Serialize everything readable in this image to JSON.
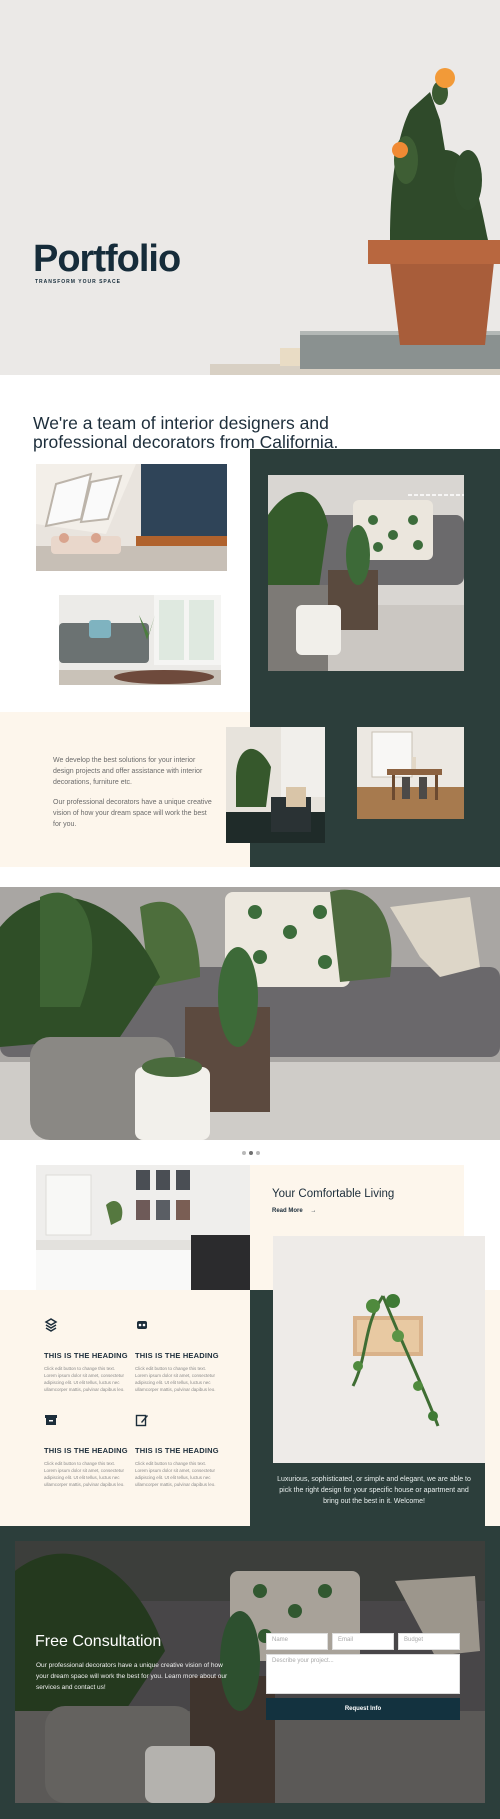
{
  "hero": {
    "title": "Portfolio",
    "subtitle": "TRANSFORM YOUR SPACE"
  },
  "intro": {
    "heading": "We're a team of interior designers and professional decorators from California."
  },
  "about": {
    "paragraph1": "We develop the best solutions for your interior design projects and offer assistance with interior decorations, furniture etc.",
    "paragraph2": "Our professional decorators have a unique creative vision of how your dream space will work the best for you."
  },
  "slider": {
    "dots": 3,
    "active": 1
  },
  "living": {
    "title": "Your Comfortable Living",
    "read_more": "Read More",
    "arrow": "→"
  },
  "features": [
    {
      "icon": "layers-icon",
      "heading": "THIS IS THE HEADING",
      "text": "Click edit button to change this text. Lorem ipsum dolor sit amet, consectetur adipiscing elit. Ut elit tellus, luctus nec ullamcorper mattis, pulvinar dapibus leo."
    },
    {
      "icon": "robot-icon",
      "heading": "THIS IS THE HEADING",
      "text": "Click edit button to change this text. Lorem ipsum dolor sit amet, consectetur adipiscing elit. Ut elit tellus, luctus nec ullamcorper mattis, pulvinar dapibus leo."
    },
    {
      "icon": "archive-icon",
      "heading": "THIS IS THE HEADING",
      "text": "Click edit button to change this text. Lorem ipsum dolor sit amet, consectetur adipiscing elit. Ut elit tellus, luctus nec ullamcorper mattis, pulvinar dapibus leo."
    },
    {
      "icon": "edit-icon",
      "heading": "THIS IS THE HEADING",
      "text": "Click edit button to change this text. Lorem ipsum dolor sit amet, consectetur adipiscing elit. Ut elit tellus, luctus nec ullamcorper mattis, pulvinar dapibus leo."
    }
  ],
  "welcome": {
    "text": "Luxurious, sophisticated, or simple and elegant, we are able to pick the right design for your specific house or apartment and bring out the best in it. Welcome!"
  },
  "consultation": {
    "title": "Free Consultation",
    "text": "Our professional decorators have a unique creative vision of how your dream space will work the best for you. Learn more about our services and contact us!",
    "name_placeholder": "Name",
    "email_placeholder": "Email",
    "budget_placeholder": "Budget",
    "message_placeholder": "Describe your project...",
    "submit_label": "Request Info"
  },
  "colors": {
    "dark_green": "#2c3e3b",
    "cream": "#fdf6ec",
    "navy": "#13323f",
    "text": "#1d2e3b"
  }
}
